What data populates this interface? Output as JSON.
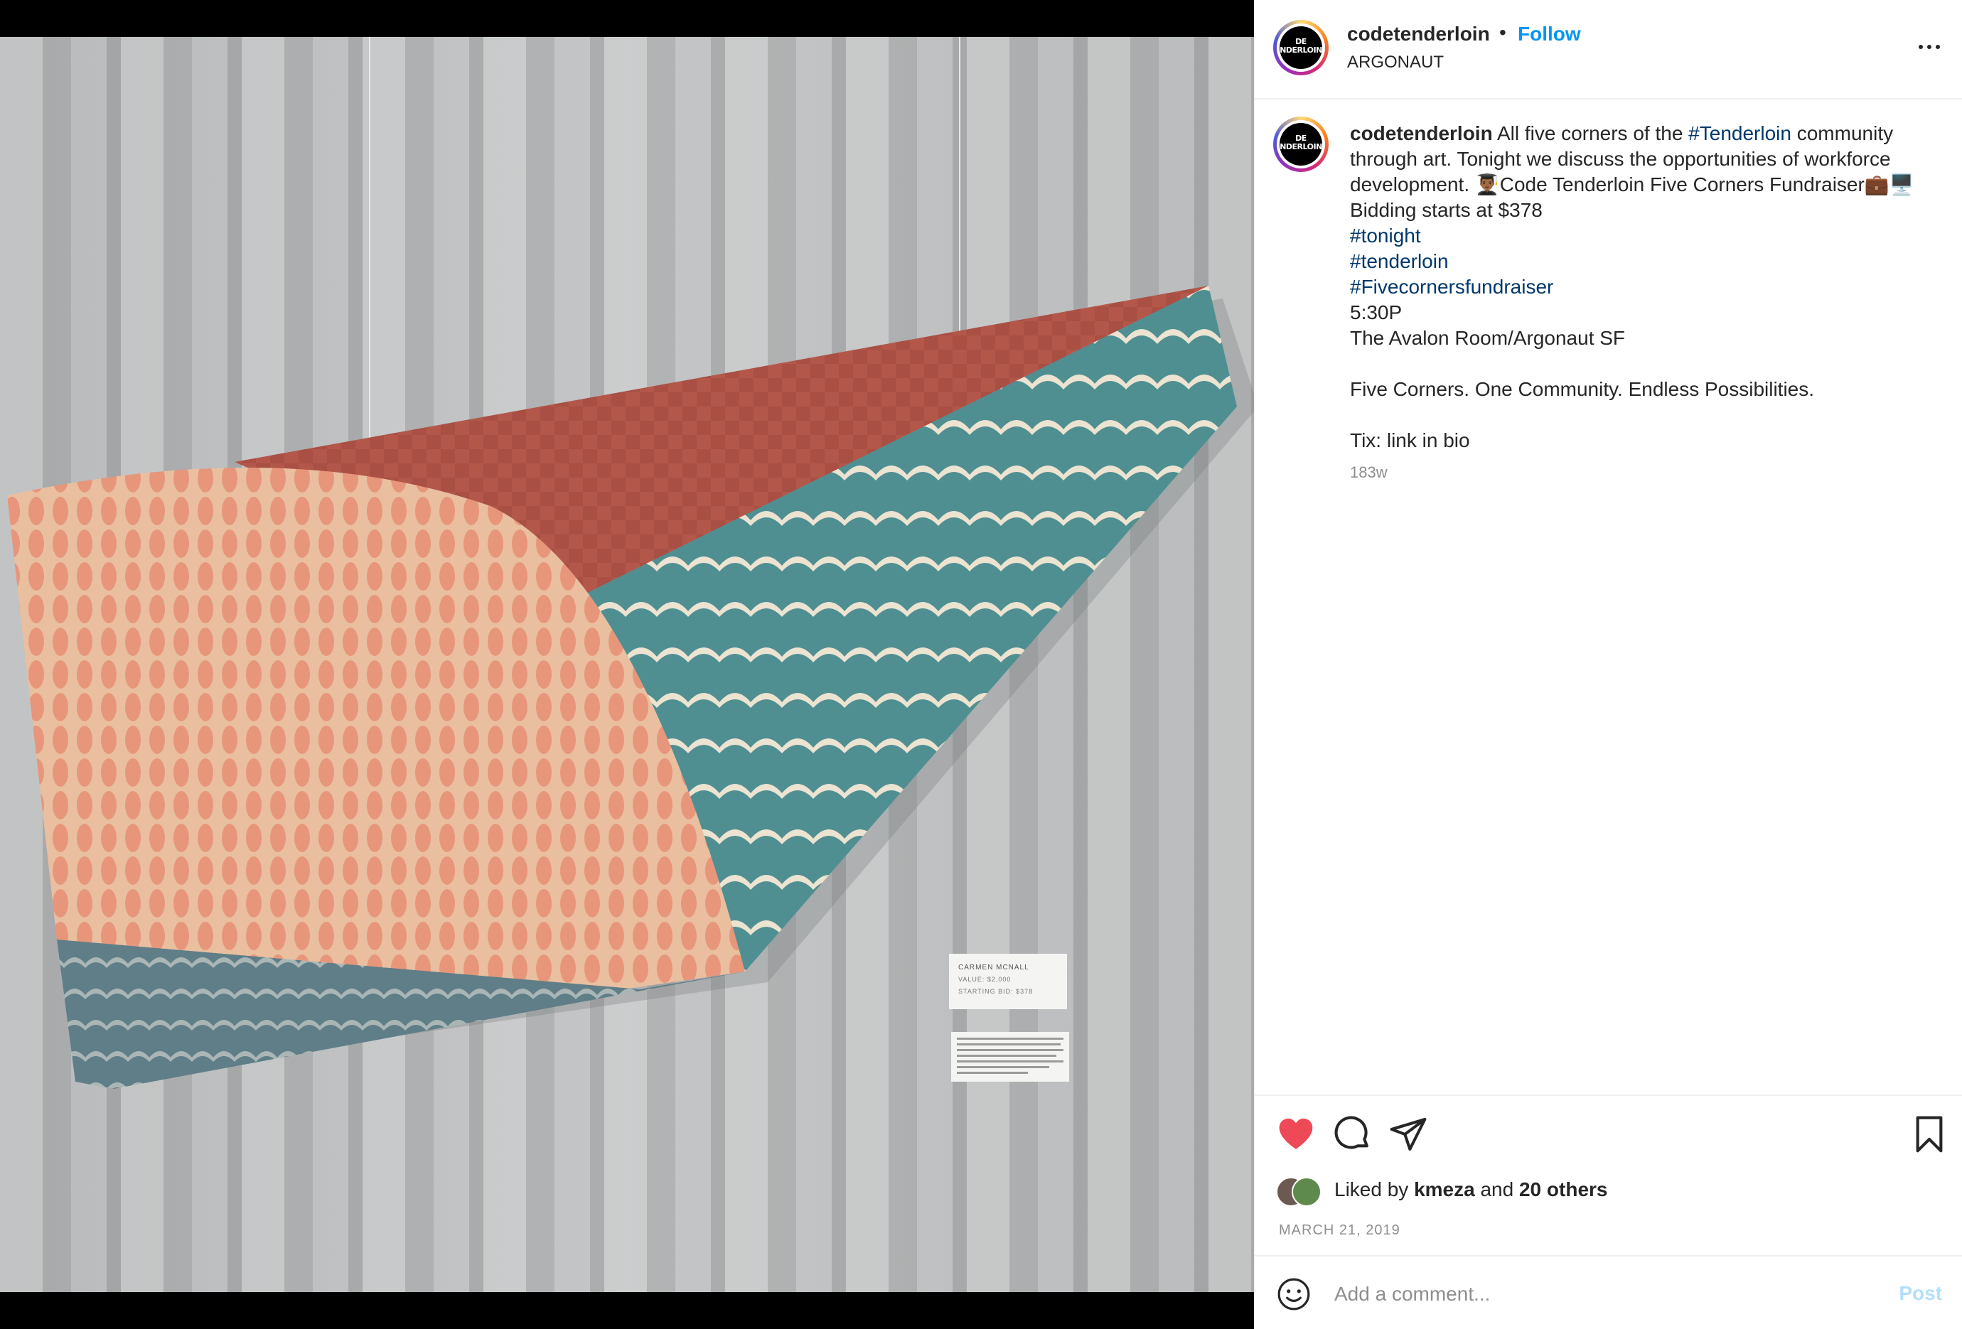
{
  "post": {
    "account": {
      "username": "codetenderloin",
      "avatar_text": "DE\nNDERLOIN",
      "location": "ARGONAUT",
      "follow_label": "Follow",
      "separator": "•"
    },
    "caption": {
      "username": "codetenderloin",
      "text_1": " All five corners of the ",
      "hashtag_1": "#Tenderloin",
      "text_2": " community through art. Tonight we discuss the opportunities of workforce development. 👨🏾‍🎓Code Tenderloin Five Corners Fundraiser💼🖥️ Bidding starts at $378\n",
      "hashtag_2": "#tonight",
      "newline_1": "\n",
      "hashtag_3": "#tenderloin",
      "newline_2": "\n",
      "hashtag_4": "#Fivecornersfundraiser",
      "text_3": "\n5:30P\nThe Avalon Room/Argonaut SF\n\nFive Corners. One Community. Endless Possibilities.\n\nTix: link in bio",
      "time_ago": "183w"
    },
    "actions": {
      "liked": true,
      "like_color": "#ed4956",
      "icons": [
        "heart-icon",
        "comment-icon",
        "share-icon",
        "bookmark-icon"
      ]
    },
    "likes": {
      "prefix": "Liked by ",
      "first_liker": "kmeza",
      "and": " and ",
      "others": "20 others"
    },
    "date": "MARCH 21, 2019",
    "comment_box": {
      "placeholder": "Add a comment...",
      "post_label": "Post"
    },
    "artwork_card": {
      "artist": "CARMEN MCNALL",
      "value": "VALUE: $2,000",
      "starting_bid": "STARTING BID: $378"
    }
  },
  "colors": {
    "accent": "#0095f6",
    "hashtag": "#00376b",
    "secondary_text": "#8e8e8e"
  }
}
